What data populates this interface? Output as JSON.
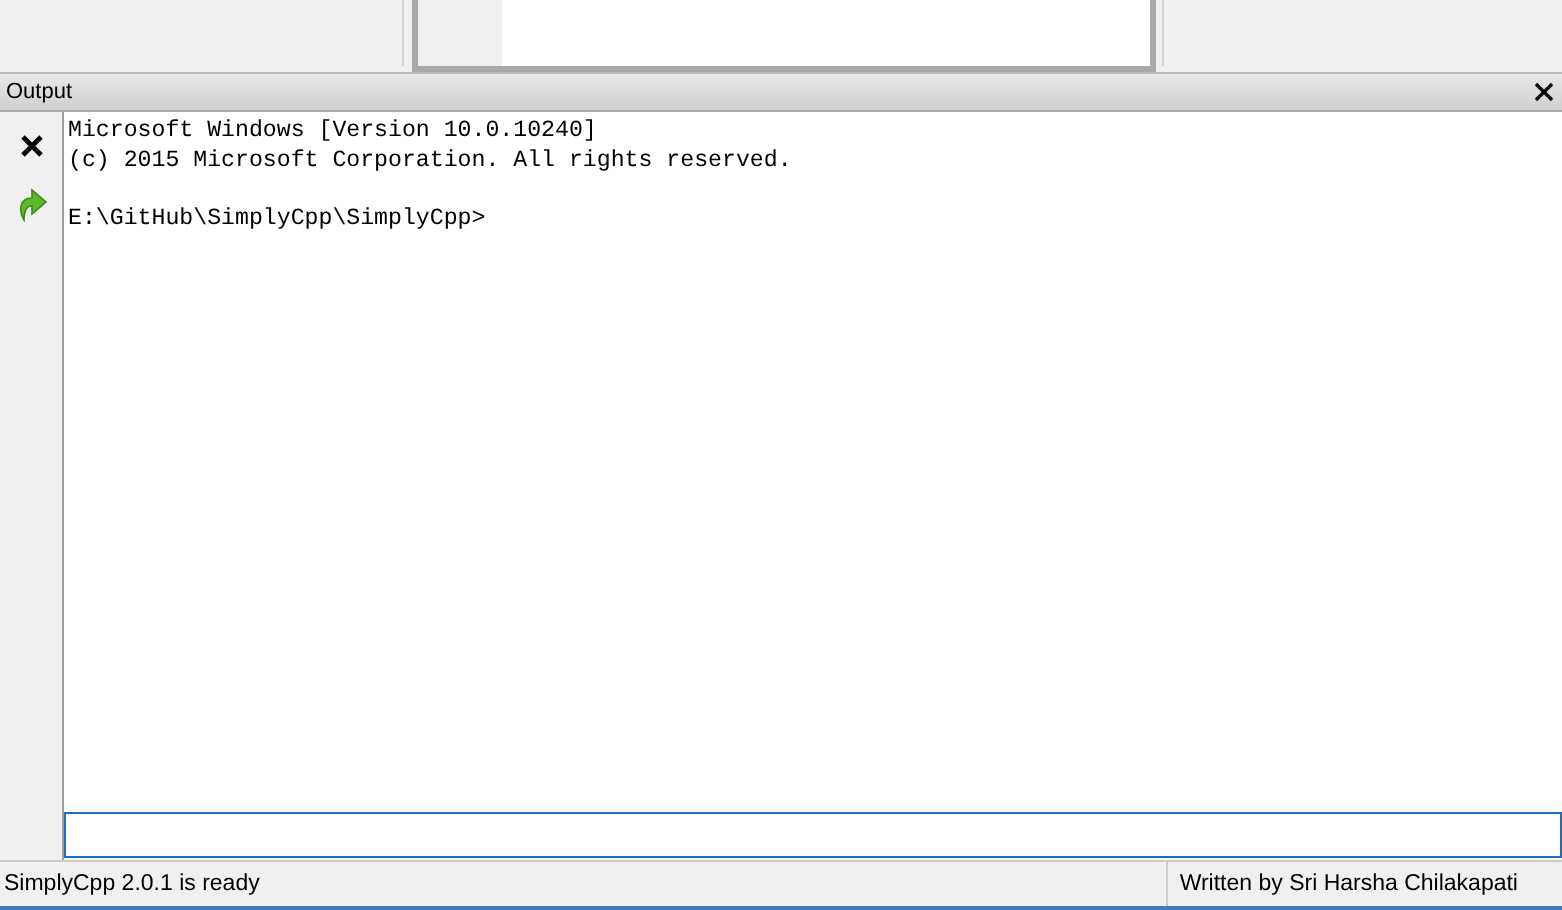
{
  "panel": {
    "title": "Output"
  },
  "console": {
    "blocks": [
      {
        "lines": [
          "Microsoft Windows [Version 10.0.10240]",
          "(c) 2015 Microsoft Corporation. All rights reserved."
        ]
      },
      {
        "lines": [
          "E:\\GitHub\\SimplyCpp\\SimplyCpp>"
        ]
      }
    ]
  },
  "status_bar": {
    "left": "SimplyCpp 2.0.1 is ready",
    "right": "Written by Sri Harsha Chilakapati"
  }
}
